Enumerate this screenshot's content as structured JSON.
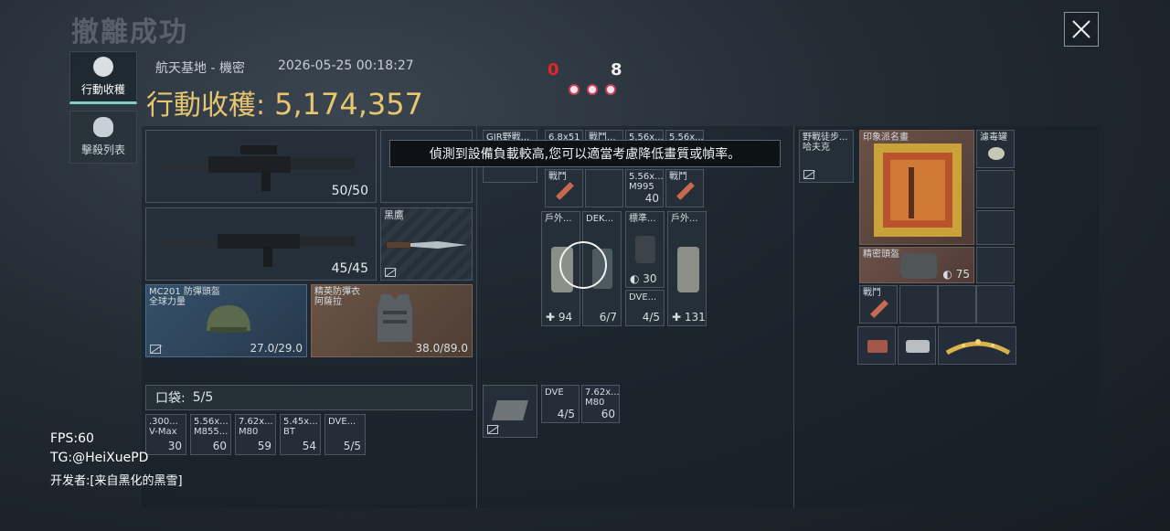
{
  "header": {
    "title": "撤離成功",
    "location": "航天基地 - 機密",
    "datetime": "2026-05-25 00:18:27",
    "loot_label": "行動收穫:",
    "loot_value": "5,174,357",
    "counter_red": "0",
    "counter_white": "8"
  },
  "sidebar": {
    "tabs": [
      {
        "label": "行動收穫"
      },
      {
        "label": "擊殺列表"
      }
    ]
  },
  "notice": "偵測到設備負載較高,您可以適當考慮降低畫質或幀率。",
  "loadout": {
    "weapon1_count": "50/50",
    "weapon2_count": "45/45",
    "melee_name": "黑鷹",
    "helmet_name": "MC201 防彈頭盔",
    "helmet_brand": "全球力量",
    "helmet_durability": "27.0/29.0",
    "armor_name": "精英防彈衣",
    "armor_brand": "阿薩拉",
    "armor_durability": "38.0/89.0"
  },
  "pocket": {
    "label": "口袋:",
    "count": "5/5",
    "items": [
      {
        "name": ".300...",
        "sub": "V-Max",
        "qty": "30"
      },
      {
        "name": "5.56x...",
        "sub": "M855...",
        "qty": "60"
      },
      {
        "name": "7.62x...",
        "sub": "M80",
        "qty": "59"
      },
      {
        "name": "5.45x...",
        "sub": "BT",
        "qty": "54"
      },
      {
        "name": "DVE...",
        "sub": "",
        "qty": "5/5"
      }
    ]
  },
  "backpack": {
    "items": [
      {
        "name": "GIR野戰...",
        "sub": "",
        "qty": ""
      },
      {
        "name": "6.8x51",
        "sub": "",
        "qty": ""
      },
      {
        "name": "戰鬥...",
        "sub": "",
        "qty": ""
      },
      {
        "name": "5.56x...",
        "sub": "",
        "qty": ""
      },
      {
        "name": "5.56x...",
        "sub": "",
        "qty": ""
      },
      {
        "name": "戰鬥",
        "sub": "",
        "qty": ""
      },
      {
        "name": "5.56x...",
        "sub": "M995",
        "qty": "40"
      },
      {
        "name": "戰鬥",
        "sub": "",
        "qty": ""
      },
      {
        "name": "戶外...",
        "sub": "",
        "qty": "94"
      },
      {
        "name": "DEK...",
        "sub": "",
        "qty": "6/7"
      },
      {
        "name": "標準...",
        "sub": "",
        "qty": "30"
      },
      {
        "name": "DVE...",
        "sub": "",
        "qty": "4/5"
      },
      {
        "name": "戶外...",
        "sub": "",
        "qty": "131"
      },
      {
        "name": "DVE",
        "sub": "",
        "qty": "4/5"
      },
      {
        "name": "7.62x...",
        "sub": "M80",
        "qty": "60"
      }
    ]
  },
  "vest": {
    "items": [
      {
        "name": "野戰徒步...",
        "sub": "哈夫克"
      },
      {
        "name": "印象派名畫",
        "sub": ""
      },
      {
        "name": "濾毒罐",
        "sub": ""
      },
      {
        "name": "精密頭盔",
        "qty": "75"
      },
      {
        "name": "戰鬥",
        "sub": ""
      }
    ]
  },
  "debug": {
    "fps": "FPS:60",
    "tg": "TG:@HeiXuePD",
    "dev": "开发者:[来自黑化的黑雪]"
  },
  "colors": {
    "gold_text": "#e7c66f",
    "red_counter": "#e0262a",
    "active_tab": "#7fd0c0"
  }
}
